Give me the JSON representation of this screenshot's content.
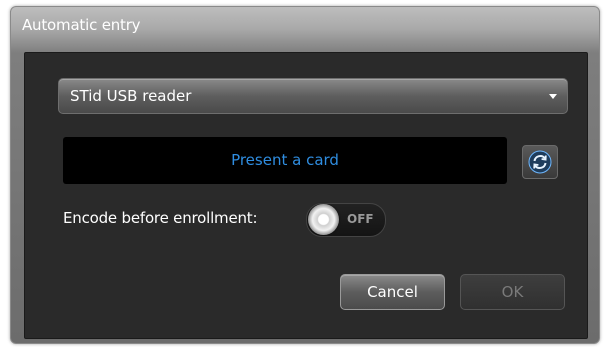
{
  "window": {
    "title": "Automatic entry"
  },
  "reader": {
    "selected": "STid USB reader",
    "caret_icon": "chevron-down-icon"
  },
  "card": {
    "message": "Present a card",
    "message_color": "#2f8de0",
    "refresh_icon": "refresh-icon"
  },
  "encode": {
    "label": "Encode before enrollment:",
    "state_label": "OFF",
    "enabled": false
  },
  "buttons": {
    "cancel_label": "Cancel",
    "ok_label": "OK",
    "ok_enabled": false
  }
}
